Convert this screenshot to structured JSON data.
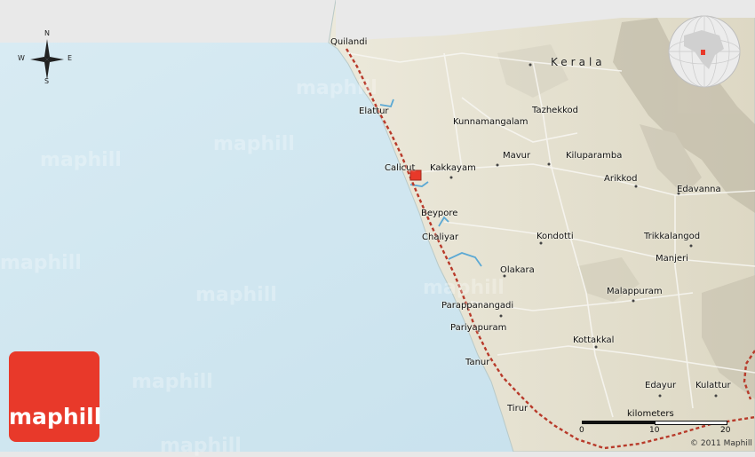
{
  "map": {
    "region_label": "Kerala",
    "colors": {
      "sea": "#cfe5ef",
      "land": "#e7e3d3",
      "rail": "#b83a2a",
      "river": "#5ca9d4",
      "logo": "#e8392a"
    },
    "places": {
      "quilandi": "Quilandi",
      "elattur": "Elattur",
      "kunnamangalam": "Kunnamangalam",
      "tazhekkod": "Tazhekkod",
      "calicut": "Calicut",
      "kakkayam": "Kakkayam",
      "mavur": "Mavur",
      "kiluparamba": "Kiluparamba",
      "arikkod": "Arikkod",
      "edavanna": "Edavanna",
      "beypore": "Beypore",
      "chaliyar": "Chaliyar",
      "kondotti": "Kondotti",
      "trikkalangod": "Trikkalangod",
      "manjeri": "Manjeri",
      "olakara": "Olakara",
      "malappuram": "Malappuram",
      "parappanangadi": "Parappanangadi",
      "pariyapuram": "Pariyapuram",
      "kottakkal": "Kottakkal",
      "tanur": "Tanur",
      "edayur": "Edayur",
      "kulattur": "Kulattur",
      "tirur": "Tirur"
    }
  },
  "compass": {
    "n": "N",
    "s": "S",
    "e": "E",
    "w": "W"
  },
  "scale": {
    "title": "kilometers",
    "ticks": [
      "0",
      "10",
      "20"
    ]
  },
  "watermark": "maphill",
  "logo": {
    "text": "maphill"
  },
  "copyright": "© 2011 Maphill"
}
